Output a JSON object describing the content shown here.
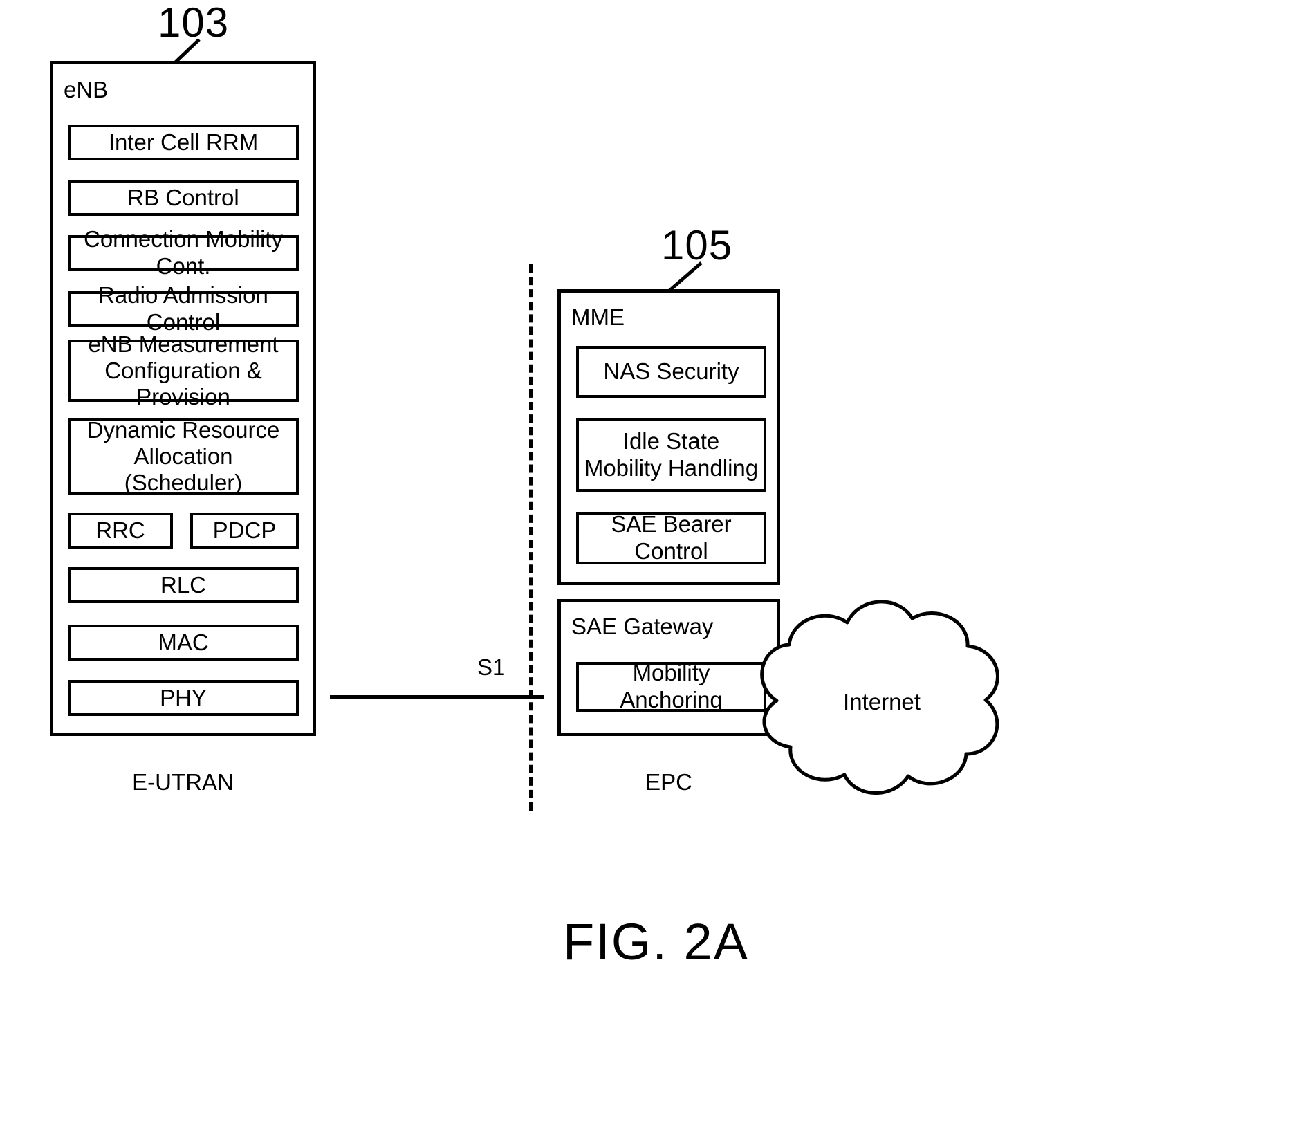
{
  "figure": {
    "caption": "FIG. 2A"
  },
  "refs": {
    "enb": "103",
    "mme": "105"
  },
  "enb": {
    "title": "eNB",
    "region_label": "E-UTRAN",
    "functions": [
      {
        "label": "Inter Cell RRM"
      },
      {
        "label": "RB  Control"
      },
      {
        "label": "Connection Mobility Cont."
      },
      {
        "label": "Radio Admission Control"
      },
      {
        "label": "eNB Measurement Configuration & Provision"
      },
      {
        "label": "Dynamic Resource Allocation (Scheduler)"
      },
      {
        "label": "RRC"
      },
      {
        "label": "PDCP"
      },
      {
        "label": "RLC"
      },
      {
        "label": "MAC"
      },
      {
        "label": "PHY"
      }
    ]
  },
  "mme": {
    "title": "MME",
    "region_label": "EPC",
    "functions": [
      {
        "label": "NAS  Security"
      },
      {
        "label": "Idle State Mobility Handling"
      },
      {
        "label": "SAE Bearer Control"
      }
    ]
  },
  "sae_gateway": {
    "title": "SAE Gateway",
    "functions": [
      {
        "label": "Mobility Anchoring"
      }
    ]
  },
  "internet": {
    "label": "Internet"
  },
  "interface": {
    "label": "S1"
  },
  "colors": {
    "stroke": "#000000",
    "background": "#ffffff"
  }
}
